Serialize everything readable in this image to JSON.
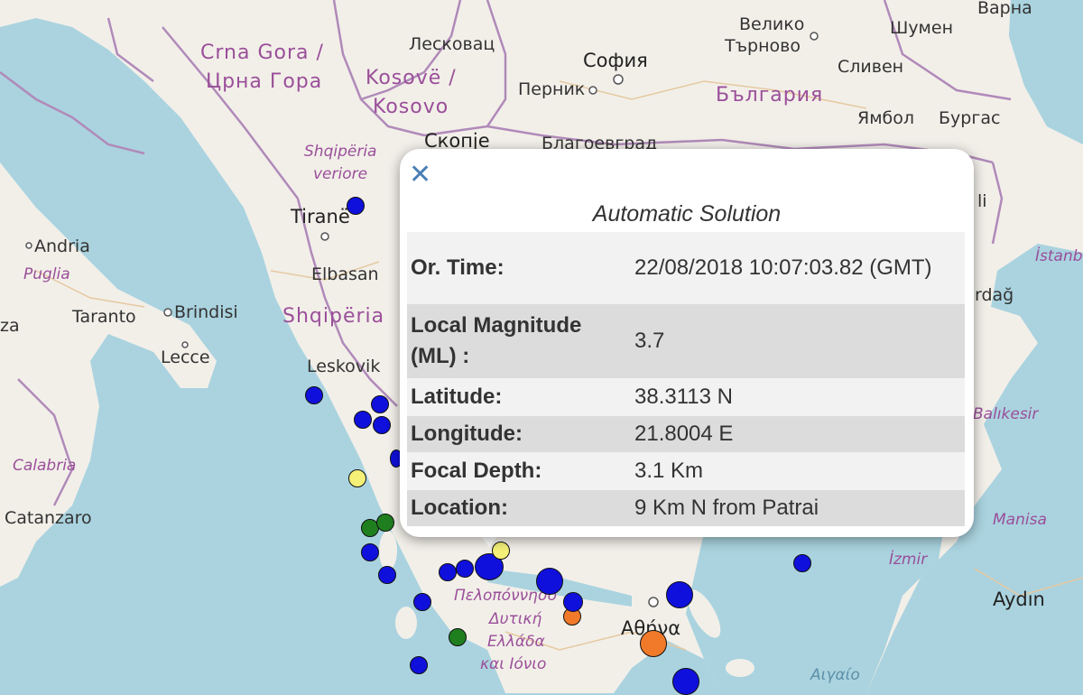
{
  "map": {
    "labels": {
      "crna_gora_1": "Crna Gora /",
      "crna_gora_2": "Црна Гора",
      "kosovo_1": "Kosovë /",
      "kosovo_2": "Kosovo",
      "leskovac": "Лесковац",
      "sofia": "София",
      "pernik": "Перник",
      "veliko": "Велико",
      "tarnovo": "Търново",
      "shumen": "Шумен",
      "varna": "Варна",
      "sliven": "Сливен",
      "bulgaria": "България",
      "yambol": "Ямбол",
      "burgas": "Бургас",
      "skopje": "Скопје",
      "blagoevgrad": "Благоевград",
      "shqiperia_veriore_1": "Shqipëria",
      "shqiperia_veriore_2": "veriore",
      "tirane": "Tiranë",
      "elbasan": "Elbasan",
      "shqiperia": "Shqipëria",
      "leskovik": "Leskovik",
      "andria": "Andria",
      "puglia": "Puglia",
      "za": "za",
      "taranto": "Taranto",
      "brindisi": "Brindisi",
      "lecce": "Lecce",
      "calabria": "Calabria",
      "catanzaro": "Catanzaro",
      "istanbul": "İstanbı",
      "dag": "rdağ",
      "li": "li",
      "balikesir": "Balıkesir",
      "manisa": "Manisa",
      "izmir": "İzmir",
      "aydin": "Aydın",
      "peloponnisos": "Πελοπόννησο",
      "dytiki_1": "Δυτική",
      "dytiki_2": "Ελλάδα",
      "dytiki_3": "και Ιόνιο",
      "athina": "Αθήνα",
      "aigaio": "Αιγαίο"
    }
  },
  "popup": {
    "close_icon": "close-icon",
    "title": "Automatic Solution",
    "rows": [
      {
        "key": "Or. Time:",
        "value": "22/08/2018 10:07:03.82 (GMT)"
      },
      {
        "key": "Local Magnitude (ML) :",
        "value": "3.7"
      },
      {
        "key": "Latitude:",
        "value": "38.3113 N"
      },
      {
        "key": "Longitude:",
        "value": "21.8004 E"
      },
      {
        "key": "Focal Depth:",
        "value": "3.1 Km"
      },
      {
        "key": "Location:",
        "value": "9 Km N from Patrai"
      }
    ]
  },
  "colors": {
    "sea": "#aad3df",
    "land": "#f2efe9",
    "border": "#b08ab9",
    "quake_blue": "#1010dd",
    "quake_green": "#1f7f1f",
    "quake_yellow": "#f4f078",
    "quake_orange": "#f07a2a"
  }
}
